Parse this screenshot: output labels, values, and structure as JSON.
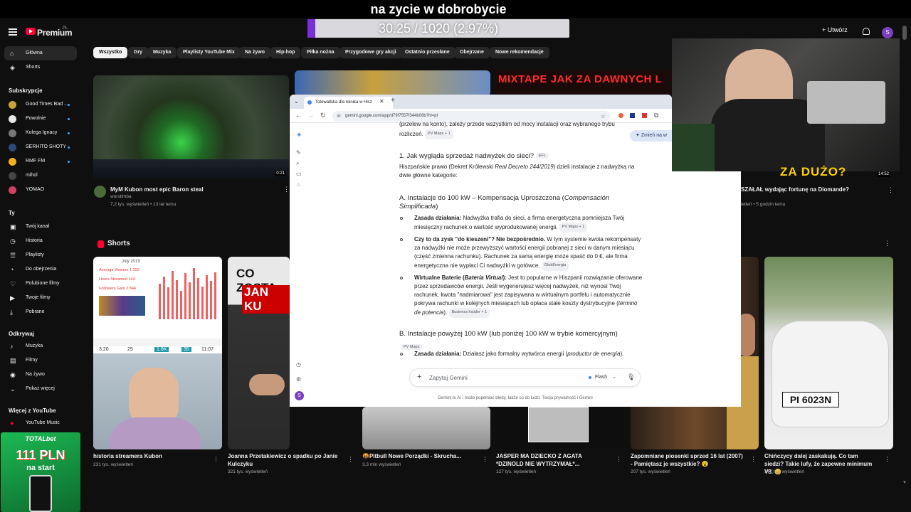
{
  "overlay": {
    "title": "na zycie w dobrobycie",
    "progress_text": "30.25 / 1020 (2.97%)",
    "progress_fraction": 0.0297
  },
  "topbar": {
    "logo": "Premium",
    "logo_country": "PL",
    "create_label": "Utwórz",
    "avatar_letter": "S"
  },
  "sidebar": {
    "main": [
      {
        "label": "Główna",
        "icon": "home-icon"
      },
      {
        "label": "Shorts",
        "icon": "shorts-icon"
      }
    ],
    "subs_header": "Subskrypcje",
    "subs": [
      {
        "label": "Good Times Bad ...",
        "color": "#c8a23a"
      },
      {
        "label": "Powolnie",
        "color": "#e9e9e9"
      },
      {
        "label": "Kolega Ignacy",
        "color": "#777777"
      },
      {
        "label": "SERHITO SHOTY",
        "color": "#2b4a7a"
      },
      {
        "label": "RMF FM",
        "color": "#f2b01e"
      },
      {
        "label": "mihol",
        "color": "#444444"
      },
      {
        "label": "YOMAO",
        "color": "#d04060"
      }
    ],
    "you_header": "Ty",
    "you": [
      {
        "label": "Twój kanał",
        "icon": "channel-icon"
      },
      {
        "label": "Historia",
        "icon": "history-icon"
      },
      {
        "label": "Playlisty",
        "icon": "playlist-icon"
      },
      {
        "label": "Do obejrzenia",
        "icon": "watch-later-icon"
      },
      {
        "label": "Polubione filmy",
        "icon": "like-icon"
      },
      {
        "label": "Twoje filmy",
        "icon": "your-videos-icon"
      },
      {
        "label": "Pobrane",
        "icon": "download-icon"
      }
    ],
    "explore_header": "Odkrywaj",
    "explore": [
      {
        "label": "Muzyka",
        "icon": "music-icon"
      },
      {
        "label": "Filmy",
        "icon": "film-icon"
      },
      {
        "label": "Na żywo",
        "icon": "live-icon"
      },
      {
        "label": "Pokaż więcej",
        "icon": "chevron-down-icon"
      }
    ],
    "more_header": "Więcej z YouTube",
    "more": [
      {
        "label": "YouTube Music",
        "icon": "youtube-music-icon"
      }
    ]
  },
  "chips": [
    "Wszystko",
    "Gry",
    "Muzyka",
    "Playlisty YouTube Mix",
    "Na żywo",
    "Hip-hop",
    "Piłka nożna",
    "Przygodowe gry akcji",
    "Ostatnio przesłane",
    "Obejrzane",
    "Nowe rekomendacje"
  ],
  "videos": [
    {
      "title": "MyM Kubon most epic Baron steal",
      "channel": "worstimba",
      "meta": "7,2 tys. wyświetleń • 13 lat temu",
      "duration": "0:21"
    },
    {
      "title": "SZAŁAŁ wydając fortunę na Diomande?",
      "channel": "",
      "meta": "ietleń • 5 godzin temu",
      "duration": "14:52"
    }
  ],
  "thumb_texts": {
    "mixtape": "MIXTAPE JAK ZA DAWNYCH L",
    "za_duzo": "ZA DUŻO?",
    "co_zosta": "CO ZOSTA",
    "jan_ku": "JAN KU"
  },
  "shorts_header": "Shorts",
  "bottom_videos": [
    {
      "title": "historia streamera Kubon",
      "meta": "231 tys. wyświetleń"
    },
    {
      "title": "Joanna Przetakiewicz o spadku po Janie Kulczyku",
      "meta": "321 tys. wyświetleń"
    },
    {
      "title": "🤬Pitbull Nowe Porządki - Skrucha...",
      "meta": "3,3 mln wyświetleń"
    },
    {
      "title": "JASPER MA DZIECKO Z AGATA *DZINOLD NIE WYTRZYMAŁ*...",
      "meta": "127 tys. wyświetleń"
    },
    {
      "title": "Zapomniane piosenki sprzed 16 lat (2007) - Pamiętasz je wszystkie? 😮",
      "meta": "207 tys. wyświetleń"
    },
    {
      "title": "Chińczycy dalej zaskakują. Co tam siedzi? Takie lufy, że zapewne minimum V8. 😊",
      "meta": "347 tys. wyświetleń"
    }
  ],
  "ad": {
    "brand": "TOTALbet",
    "amount": "111 PLN",
    "sub": "na start"
  },
  "stats_card": {
    "month": "July 2019",
    "l1": "Average Viewers 1 319",
    "l2": "Hours Streamed 144",
    "l3": "Followers Gain 2 844",
    "f1": "3:20",
    "f2": "25",
    "f3": "1.6K",
    "f4": "35",
    "f5": "11:07"
  },
  "browser": {
    "tab_title": "Totowałtska dla rolnika w Hisz",
    "url": "gemini.google.com/app/d79f7557f344b08b?hl=pl",
    "change_btn": "Zmień na w",
    "content": {
      "top_line": "(przelew na konto), zależy przede wszystkim od mocy instalacji oraz wybranego trybu",
      "top_line2": "rozliczeń.",
      "top_src": "PV Maps + 1",
      "h1": "1. Jak wygląda sprzedaż nadwyżek do sieci?",
      "h1_src": "EFL",
      "p1a": "Hiszpańskie prawo (Dekret Królewski ",
      "p1_italic": "Real Decreto 244/2019",
      "p1b": ") dzieli instalacje z nadwyżką na",
      "p1c": "dwie główne kategorie:",
      "hA": "A. Instalacje do 100 kW – Kompensacja Uproszczona (",
      "hA_italic": "Compensación",
      "hA2": "Simplificada",
      "hA3": ")",
      "b1_bold": "Zasada działania:",
      "b1": " Nadwyżka trafia do sieci, a firma energetyczna pomniejsza Twój",
      "b1c": "miesięczny rachunek o wartość wyprodukowanej energii.",
      "b1_src": "PV Maps + 1",
      "b2_bold": "Czy to da zysk \"do kieszeni\"? Nie bezpośrednio.",
      "b2": " W tym systemie kwota rekompensaty",
      "b2c": "za nadwyżki nie może przewyższyć wartości energii pobranej z sieci w danym miesiącu",
      "b2d": "(część zmienna rachunku). Rachunek za samą energię może spaść do 0 €, ale firma",
      "b2e": "energetyczna nie wypłaci Ci nadwyżki w gotówce.",
      "b2_src": "GlobEnergia",
      "b3_bold": "Wirtualne Baterie (",
      "b3_bi": "Batería Virtual",
      "b3_bold2": "):",
      "b3": " Jest to popularne w Hiszpanii rozwiązanie oferowane",
      "b3c": "przez sprzedawców energii. Jeśli wygenerujesz więcej nadwyżek, niż wynosi Twój",
      "b3d": "rachunek, kwota \"nadmiarowa\" jest zapisywana w wirtualnym portfelu i automatycznie",
      "b3e": "pokrywa rachunki w kolejnych miesiącach lub opłaca stałe koszty dystrybucyjne (",
      "b3e_it": "término",
      "b3f_it": "de potencia",
      "b3f": ").",
      "b3_src": "Business Insider + 1",
      "hB": "B. Instalacje powyżej 100 kW (lub poniżej 100 kW w trybie komercyjnym)",
      "hB_src": "PV Maps",
      "c1_bold": "Zasada działania:",
      "c1": " Działasz jako formalny wytwórca energii (",
      "c1_it": "productor de energía",
      "c1b": ")."
    },
    "ask_placeholder": "Zapytaj Gemini",
    "model": "Flash",
    "disclaimer": "Gemini to AI i może popełniać błędy, także co do ludzi. Twoja prywatność i Gemini"
  }
}
